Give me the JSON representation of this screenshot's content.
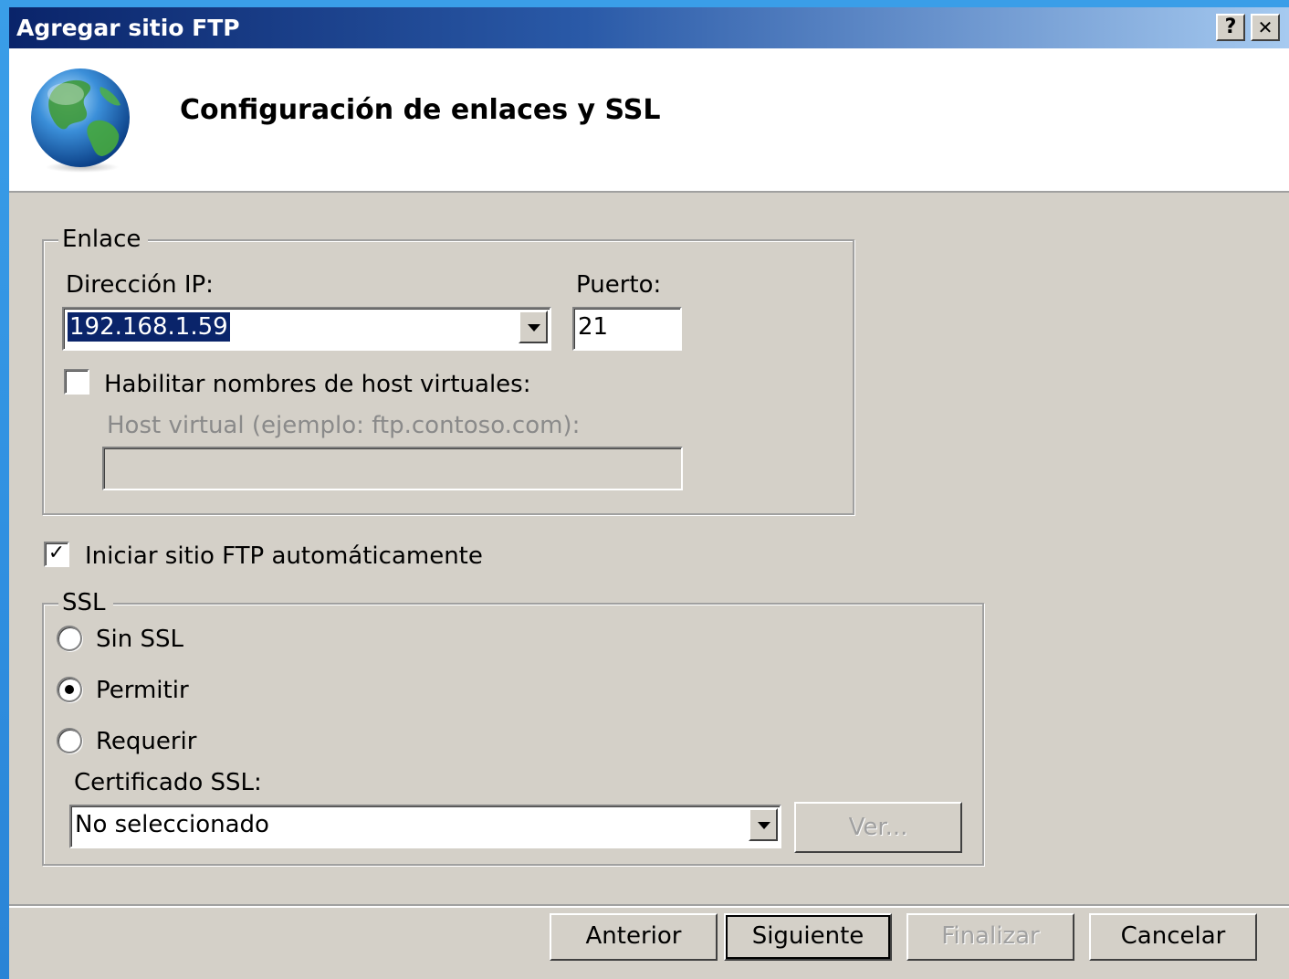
{
  "window": {
    "title": "Agregar sitio FTP",
    "help_button": "?",
    "close_button": "✕"
  },
  "header": {
    "title": "Configuración de enlaces y SSL",
    "icon": "globe-icon"
  },
  "binding": {
    "group_label": "Enlace",
    "ip_label": "Dirección IP:",
    "ip_value": "192.168.1.59",
    "port_label": "Puerto:",
    "port_value": "21",
    "virtual_host_checkbox_label": "Habilitar nombres de host virtuales:",
    "virtual_host_checked": false,
    "virtual_host_label": "Host virtual (ejemplo: ftp.contoso.com):",
    "virtual_host_value": ""
  },
  "autostart": {
    "label": "Iniciar sitio FTP automáticamente",
    "checked": true,
    "check_mark": "✓"
  },
  "ssl": {
    "group_label": "SSL",
    "options": [
      {
        "label": "Sin SSL",
        "checked": false
      },
      {
        "label": "Permitir",
        "checked": true
      },
      {
        "label": "Requerir",
        "checked": false
      }
    ],
    "certificate_label": "Certificado SSL:",
    "certificate_value": "No seleccionado",
    "view_button": "Ver..."
  },
  "footer": {
    "previous": "Anterior",
    "next": "Siguiente",
    "finish": "Finalizar",
    "cancel": "Cancelar"
  },
  "colors": {
    "desktop": "#2f8fe0",
    "titlebar_start": "#0a246a",
    "titlebar_end": "#a6caf0",
    "dialog_face": "#d4d0c8",
    "selection": "#0a246a"
  }
}
